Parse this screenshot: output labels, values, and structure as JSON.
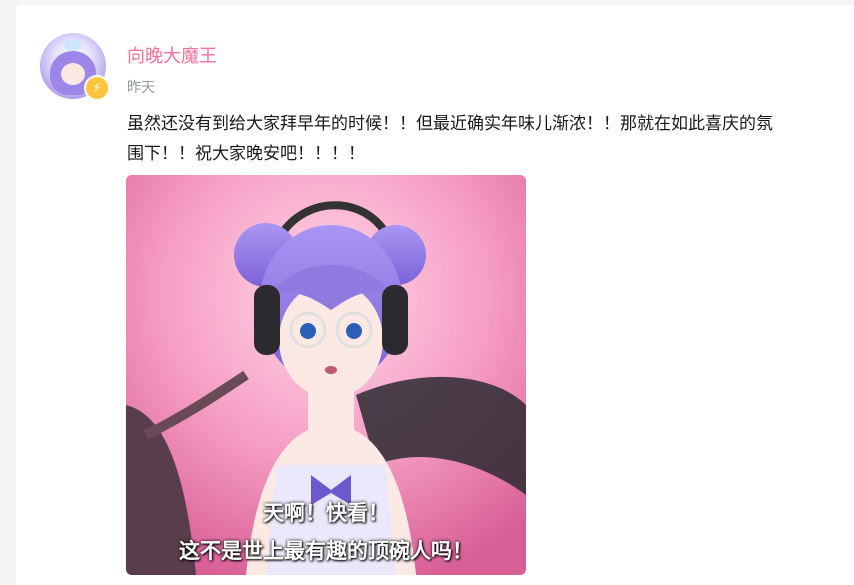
{
  "post": {
    "author": {
      "name": "向晚大魔王",
      "badge_icon": "lightning-icon"
    },
    "time": "昨天",
    "text": "虽然还没有到给大家拜早年的时候！！但最近确实年味儿渐浓！！那就在如此喜庆的氛围下！！祝大家晚安吧！！！！",
    "image": {
      "caption_line1": "天啊！快看！",
      "caption_line2": "这不是世上最有趣的顶碗人吗！"
    }
  },
  "colors": {
    "username": "#fb7299",
    "meta": "#9499a0",
    "text": "#18191c",
    "badge": "#ffc53d"
  }
}
